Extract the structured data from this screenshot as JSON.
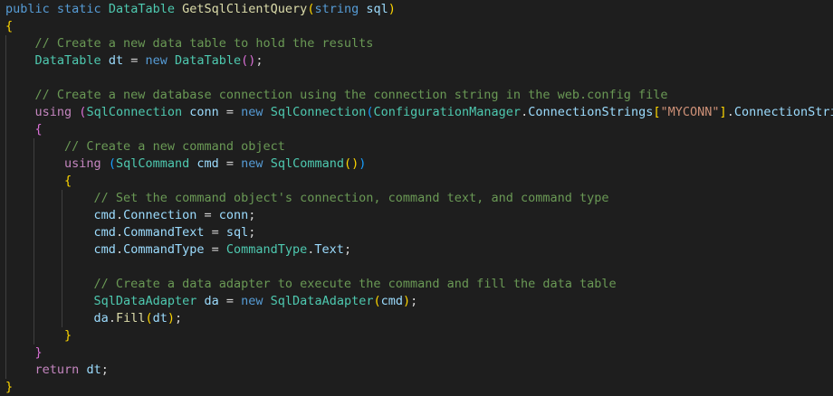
{
  "editor": {
    "language": "csharp",
    "background": "#1e1e1e",
    "token_colors": {
      "kw": "#569cd6",
      "ctl": "#c586c0",
      "type": "#4ec9b0",
      "fn": "#dcdcaa",
      "var": "#9cdcfe",
      "str": "#ce9178",
      "com": "#6a9955",
      "p1": "#ffd700",
      "p2": "#da70d6",
      "p3": "#179fff",
      "pl": "#d4d4d4"
    },
    "lines": [
      {
        "tokens": [
          [
            "kw",
            "public"
          ],
          [
            "pl",
            " "
          ],
          [
            "kw",
            "static"
          ],
          [
            "pl",
            " "
          ],
          [
            "type",
            "DataTable"
          ],
          [
            "pl",
            " "
          ],
          [
            "fn",
            "GetSqlClientQuery"
          ],
          [
            "p1",
            "("
          ],
          [
            "kw",
            "string"
          ],
          [
            "pl",
            " "
          ],
          [
            "var",
            "sql"
          ],
          [
            "p1",
            ")"
          ]
        ]
      },
      {
        "tokens": [
          [
            "p1",
            "{"
          ]
        ]
      },
      {
        "tokens": [
          [
            "pl",
            "    "
          ],
          [
            "com",
            "// Create a new data table to hold the results"
          ]
        ]
      },
      {
        "tokens": [
          [
            "pl",
            "    "
          ],
          [
            "type",
            "DataTable"
          ],
          [
            "pl",
            " "
          ],
          [
            "var",
            "dt"
          ],
          [
            "pl",
            " = "
          ],
          [
            "kw",
            "new"
          ],
          [
            "pl",
            " "
          ],
          [
            "type",
            "DataTable"
          ],
          [
            "p2",
            "()"
          ],
          [
            "pl",
            ";"
          ]
        ]
      },
      {
        "tokens": []
      },
      {
        "tokens": [
          [
            "pl",
            "    "
          ],
          [
            "com",
            "// Create a new database connection using the connection string in the web.config file"
          ]
        ]
      },
      {
        "tokens": [
          [
            "pl",
            "    "
          ],
          [
            "ctl",
            "using"
          ],
          [
            "pl",
            " "
          ],
          [
            "p2",
            "("
          ],
          [
            "type",
            "SqlConnection"
          ],
          [
            "pl",
            " "
          ],
          [
            "var",
            "conn"
          ],
          [
            "pl",
            " = "
          ],
          [
            "kw",
            "new"
          ],
          [
            "pl",
            " "
          ],
          [
            "type",
            "SqlConnection"
          ],
          [
            "p3",
            "("
          ],
          [
            "type",
            "ConfigurationManager"
          ],
          [
            "pl",
            "."
          ],
          [
            "var",
            "ConnectionStrings"
          ],
          [
            "p1",
            "["
          ],
          [
            "str",
            "\"MYCONN\""
          ],
          [
            "p1",
            "]"
          ],
          [
            "pl",
            "."
          ],
          [
            "var",
            "ConnectionString"
          ],
          [
            "p3",
            ")"
          ],
          [
            "p2",
            ")"
          ]
        ]
      },
      {
        "tokens": [
          [
            "pl",
            "    "
          ],
          [
            "p2",
            "{"
          ]
        ]
      },
      {
        "tokens": [
          [
            "pl",
            "        "
          ],
          [
            "com",
            "// Create a new command object"
          ]
        ]
      },
      {
        "tokens": [
          [
            "pl",
            "        "
          ],
          [
            "ctl",
            "using"
          ],
          [
            "pl",
            " "
          ],
          [
            "p3",
            "("
          ],
          [
            "type",
            "SqlCommand"
          ],
          [
            "pl",
            " "
          ],
          [
            "var",
            "cmd"
          ],
          [
            "pl",
            " = "
          ],
          [
            "kw",
            "new"
          ],
          [
            "pl",
            " "
          ],
          [
            "type",
            "SqlCommand"
          ],
          [
            "p1",
            "()"
          ],
          [
            "p3",
            ")"
          ]
        ]
      },
      {
        "tokens": [
          [
            "pl",
            "        "
          ],
          [
            "p1",
            "{"
          ]
        ]
      },
      {
        "tokens": [
          [
            "pl",
            "            "
          ],
          [
            "com",
            "// Set the command object's connection, command text, and command type"
          ]
        ]
      },
      {
        "tokens": [
          [
            "pl",
            "            "
          ],
          [
            "var",
            "cmd"
          ],
          [
            "pl",
            "."
          ],
          [
            "var",
            "Connection"
          ],
          [
            "pl",
            " = "
          ],
          [
            "var",
            "conn"
          ],
          [
            "pl",
            ";"
          ]
        ]
      },
      {
        "tokens": [
          [
            "pl",
            "            "
          ],
          [
            "var",
            "cmd"
          ],
          [
            "pl",
            "."
          ],
          [
            "var",
            "CommandText"
          ],
          [
            "pl",
            " = "
          ],
          [
            "var",
            "sql"
          ],
          [
            "pl",
            ";"
          ]
        ]
      },
      {
        "tokens": [
          [
            "pl",
            "            "
          ],
          [
            "var",
            "cmd"
          ],
          [
            "pl",
            "."
          ],
          [
            "var",
            "CommandType"
          ],
          [
            "pl",
            " = "
          ],
          [
            "type",
            "CommandType"
          ],
          [
            "pl",
            "."
          ],
          [
            "var",
            "Text"
          ],
          [
            "pl",
            ";"
          ]
        ]
      },
      {
        "tokens": []
      },
      {
        "tokens": [
          [
            "pl",
            "            "
          ],
          [
            "com",
            "// Create a data adapter to execute the command and fill the data table"
          ]
        ]
      },
      {
        "tokens": [
          [
            "pl",
            "            "
          ],
          [
            "type",
            "SqlDataAdapter"
          ],
          [
            "pl",
            " "
          ],
          [
            "var",
            "da"
          ],
          [
            "pl",
            " = "
          ],
          [
            "kw",
            "new"
          ],
          [
            "pl",
            " "
          ],
          [
            "type",
            "SqlDataAdapter"
          ],
          [
            "p1",
            "("
          ],
          [
            "var",
            "cmd"
          ],
          [
            "p1",
            ")"
          ],
          [
            "pl",
            ";"
          ]
        ]
      },
      {
        "tokens": [
          [
            "pl",
            "            "
          ],
          [
            "var",
            "da"
          ],
          [
            "pl",
            "."
          ],
          [
            "fn",
            "Fill"
          ],
          [
            "p1",
            "("
          ],
          [
            "var",
            "dt"
          ],
          [
            "p1",
            ")"
          ],
          [
            "pl",
            ";"
          ]
        ]
      },
      {
        "tokens": [
          [
            "pl",
            "        "
          ],
          [
            "p1",
            "}"
          ]
        ]
      },
      {
        "tokens": [
          [
            "pl",
            "    "
          ],
          [
            "p2",
            "}"
          ]
        ]
      },
      {
        "tokens": [
          [
            "pl",
            "    "
          ],
          [
            "ctl",
            "return"
          ],
          [
            "pl",
            " "
          ],
          [
            "var",
            "dt"
          ],
          [
            "pl",
            ";"
          ]
        ]
      },
      {
        "tokens": [
          [
            "p1",
            "}"
          ]
        ]
      }
    ]
  }
}
